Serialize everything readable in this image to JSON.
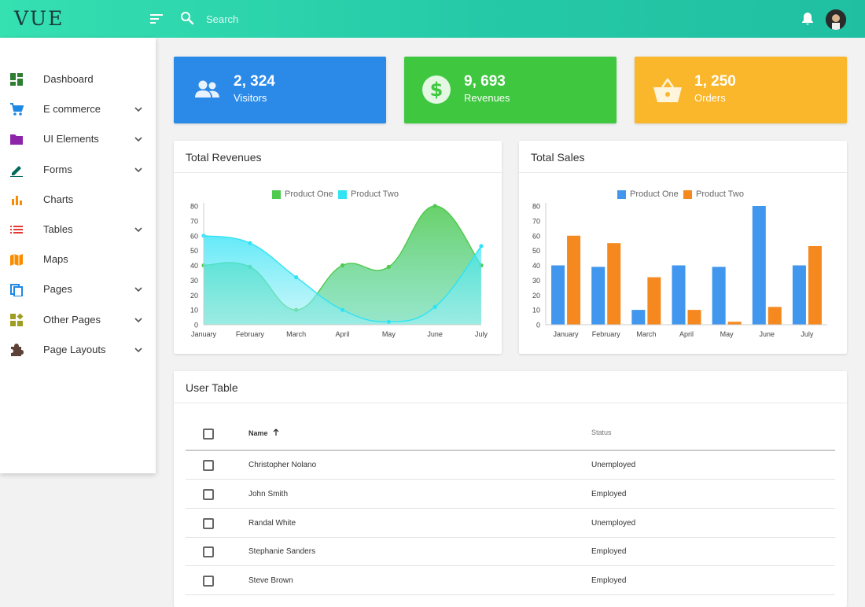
{
  "app": {
    "brand": "VUE"
  },
  "header": {
    "search_placeholder": "Search"
  },
  "sidebar": {
    "items": [
      {
        "label": "Dashboard",
        "icon": "dashboard-icon",
        "color": "#2e7d32",
        "has_children": false
      },
      {
        "label": "E commerce",
        "icon": "cart-icon",
        "color": "#1e88e5",
        "has_children": true
      },
      {
        "label": "UI Elements",
        "icon": "folder-icon",
        "color": "#8e24aa",
        "has_children": true
      },
      {
        "label": "Forms",
        "icon": "pencil-icon",
        "color": "#00695c",
        "has_children": true
      },
      {
        "label": "Charts",
        "icon": "bar-chart-icon",
        "color": "#fb8c00",
        "has_children": false
      },
      {
        "label": "Tables",
        "icon": "list-icon",
        "color": "#e53935",
        "has_children": true
      },
      {
        "label": "Maps",
        "icon": "map-icon",
        "color": "#fb8c00",
        "has_children": false
      },
      {
        "label": "Pages",
        "icon": "copy-icon",
        "color": "#1e88e5",
        "has_children": true
      },
      {
        "label": "Other Pages",
        "icon": "widgets-icon",
        "color": "#9e9d24",
        "has_children": true
      },
      {
        "label": "Page Layouts",
        "icon": "puzzle-icon",
        "color": "#5d4037",
        "has_children": true
      }
    ]
  },
  "stats": [
    {
      "value": "2, 324",
      "label": "Visitors",
      "icon": "users-icon",
      "color": "#2b8ae8"
    },
    {
      "value": "9, 693",
      "label": "Revenues",
      "icon": "dollar-icon",
      "color": "#3fc73f"
    },
    {
      "value": "1, 250",
      "label": "Orders",
      "icon": "basket-icon",
      "color": "#fbb72b"
    }
  ],
  "revenues_card": {
    "title": "Total Revenues"
  },
  "sales_card": {
    "title": "Total Sales"
  },
  "chart_data": [
    {
      "type": "area",
      "title": "Total Revenues",
      "categories": [
        "January",
        "February",
        "March",
        "April",
        "May",
        "June",
        "July"
      ],
      "ylim": [
        0,
        80
      ],
      "yticks": [
        0,
        10,
        20,
        30,
        40,
        50,
        60,
        70,
        80
      ],
      "legend": "top-center",
      "series": [
        {
          "name": "Product One",
          "values": [
            40,
            39,
            10,
            40,
            39,
            80,
            40
          ],
          "color": "#4fc94f"
        },
        {
          "name": "Product Two",
          "values": [
            60,
            55,
            32,
            10,
            2,
            12,
            53
          ],
          "color": "#2fe3f5"
        }
      ]
    },
    {
      "type": "bar",
      "title": "Total Sales",
      "categories": [
        "January",
        "February",
        "March",
        "April",
        "May",
        "June",
        "July"
      ],
      "ylim": [
        0,
        80
      ],
      "yticks": [
        0,
        10,
        20,
        30,
        40,
        50,
        60,
        70,
        80
      ],
      "legend": "top-center",
      "series": [
        {
          "name": "Product One",
          "values": [
            40,
            39,
            10,
            40,
            39,
            80,
            40
          ],
          "color": "#4196ee"
        },
        {
          "name": "Product Two",
          "values": [
            60,
            55,
            32,
            10,
            2,
            12,
            53
          ],
          "color": "#f5891f"
        }
      ]
    }
  ],
  "user_table": {
    "title": "User Table",
    "columns": {
      "name": "Name",
      "status": "Status"
    },
    "rows": [
      {
        "name": "Christopher Nolano",
        "status": "Unemployed"
      },
      {
        "name": "John Smith",
        "status": "Employed"
      },
      {
        "name": "Randal White",
        "status": "Unemployed"
      },
      {
        "name": "Stephanie Sanders",
        "status": "Employed"
      },
      {
        "name": "Steve Brown",
        "status": "Employed"
      }
    ]
  }
}
